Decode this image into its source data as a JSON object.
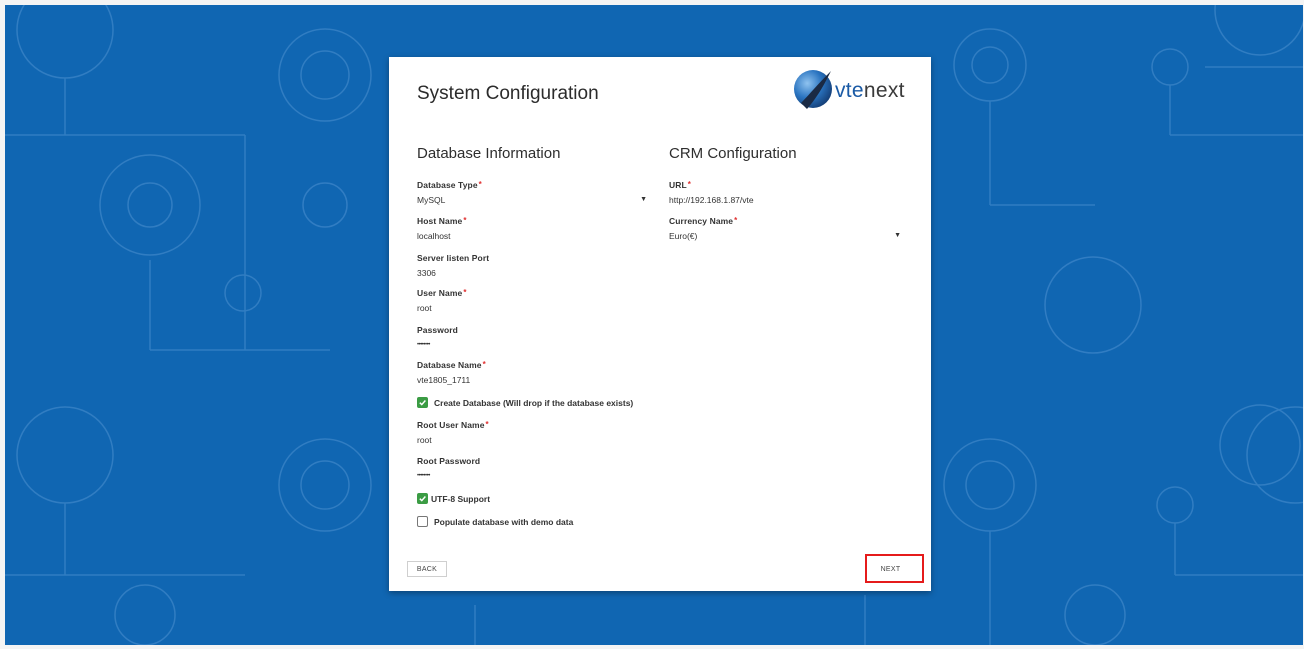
{
  "page": {
    "title": "System Configuration",
    "logo": {
      "text_prefix": "vte",
      "text_suffix": "next"
    }
  },
  "database": {
    "section_title": "Database Information",
    "fields": [
      {
        "label": "Database Type",
        "required": true,
        "value": "MySQL",
        "type": "select"
      },
      {
        "label": "Host Name",
        "required": true,
        "value": "localhost"
      },
      {
        "label": "Server listen Port",
        "required": false,
        "value": "3306"
      },
      {
        "label": "User Name",
        "required": true,
        "value": "root"
      },
      {
        "label": "Password",
        "required": false,
        "value": "••••••••"
      },
      {
        "label": "Database Name",
        "required": true,
        "value": "vte1805_1711"
      }
    ],
    "create_db": {
      "label": "Create Database (Will drop if the database exists)",
      "checked": true
    },
    "root_fields": [
      {
        "label": "Root User Name",
        "required": true,
        "value": "root"
      },
      {
        "label": "Root Password",
        "required": false,
        "value": "••••••••"
      }
    ],
    "utf8": {
      "label": "UTF-8 Support",
      "checked": true
    },
    "demo": {
      "label": "Populate database with demo data",
      "checked": false
    }
  },
  "crm": {
    "section_title": "CRM Configuration",
    "url": {
      "label": "URL",
      "required": true,
      "value": "http://192.168.1.87/vte"
    },
    "currency": {
      "label": "Currency Name",
      "required": true,
      "value": "Euro(€)",
      "type": "select"
    }
  },
  "buttons": {
    "back": "BACK",
    "next": "NEXT"
  },
  "colors": {
    "background": "#1066b2",
    "checkbox_checked": "#3b9c44",
    "highlight": "#e51b1b",
    "required_star": "#e03131"
  },
  "icons": [
    "vtenext-globe-logo-icon",
    "caret-down-icon",
    "checkmark-icon"
  ]
}
